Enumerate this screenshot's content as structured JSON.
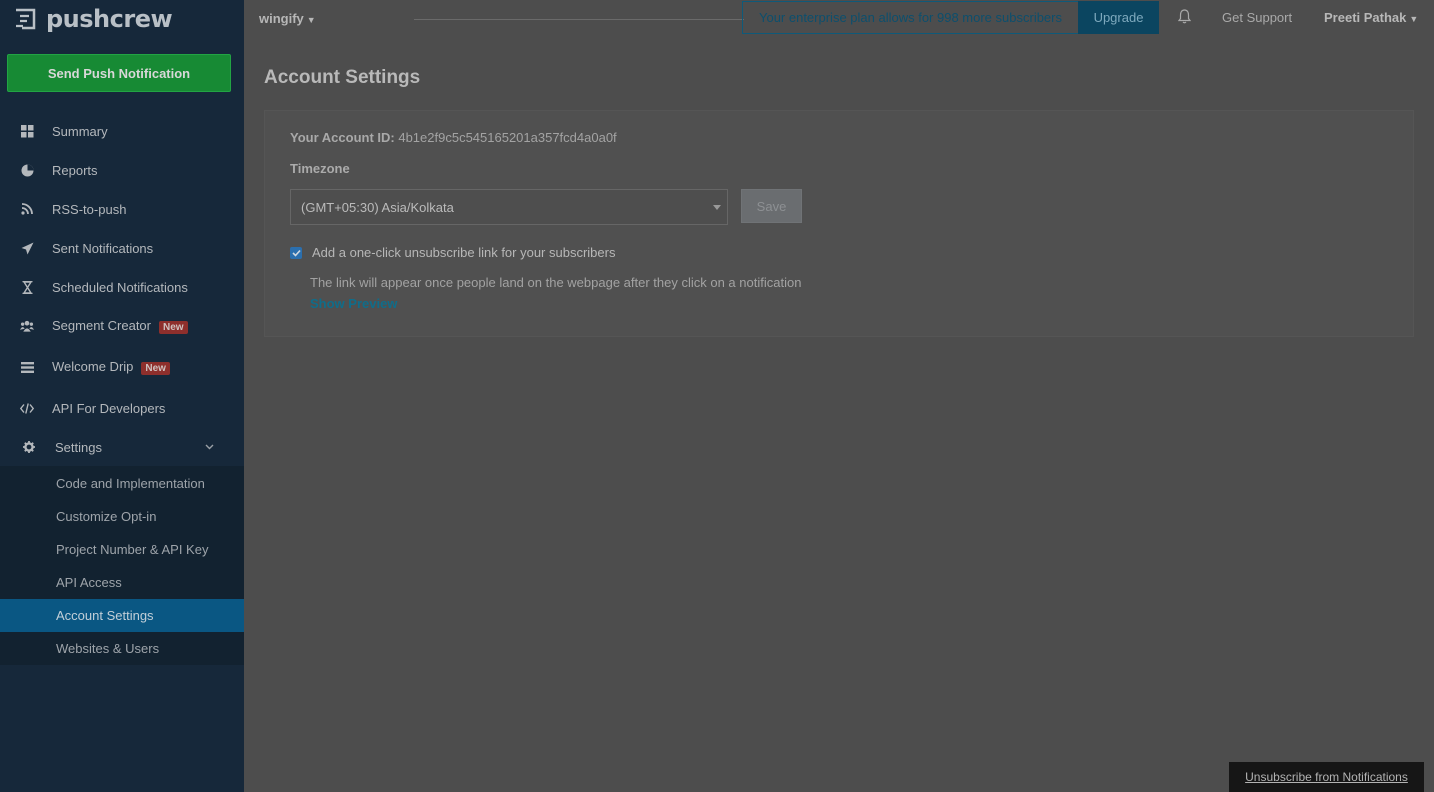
{
  "brand": {
    "name": "pushcrew"
  },
  "sidebar": {
    "send_button": "Send Push Notification",
    "items": [
      {
        "label": "Summary",
        "icon": "dashboard-icon"
      },
      {
        "label": "Reports",
        "icon": "pie-chart-icon"
      },
      {
        "label": "RSS-to-push",
        "icon": "rss-icon"
      },
      {
        "label": "Sent Notifications",
        "icon": "paper-plane-icon"
      },
      {
        "label": "Scheduled Notifications",
        "icon": "hourglass-icon"
      },
      {
        "label": "Segment Creator",
        "icon": "users-icon",
        "badge": "New"
      },
      {
        "label": "Welcome Drip",
        "icon": "list-icon",
        "badge": "New"
      },
      {
        "label": "API For Developers",
        "icon": "code-icon"
      },
      {
        "label": "Settings",
        "icon": "gear-icon"
      }
    ],
    "settings_submenu": [
      {
        "label": "Code and Implementation"
      },
      {
        "label": "Customize Opt-in"
      },
      {
        "label": "Project Number & API Key"
      },
      {
        "label": "API Access"
      },
      {
        "label": "Account Settings",
        "active": true
      },
      {
        "label": "Websites & Users"
      }
    ]
  },
  "topbar": {
    "project": "wingify",
    "plan_message": "Your enterprise plan allows for 998 more subscribers",
    "upgrade": "Upgrade",
    "support": "Get Support",
    "user": "Preeti Pathak"
  },
  "main": {
    "title": "Account Settings",
    "account_id_label": "Your Account ID:",
    "account_id": "4b1e2f9c5c545165201a357fcd4a0a0f",
    "timezone_label": "Timezone",
    "timezone_value": "(GMT+05:30) Asia/Kolkata",
    "save": "Save",
    "unsubscribe_checkbox_label": "Add a one-click unsubscribe link for your subscribers",
    "unsubscribe_checked": true,
    "helper": "The link will appear once people land on the webpage after they click on a notification",
    "show_preview": "Show Preview"
  },
  "footer": {
    "unsubscribe": "Unsubscribe from Notifications"
  },
  "colors": {
    "sidebar": "#16283a",
    "accent": "#0a5783",
    "send": "#178a34",
    "badge": "#8e2f2c"
  }
}
